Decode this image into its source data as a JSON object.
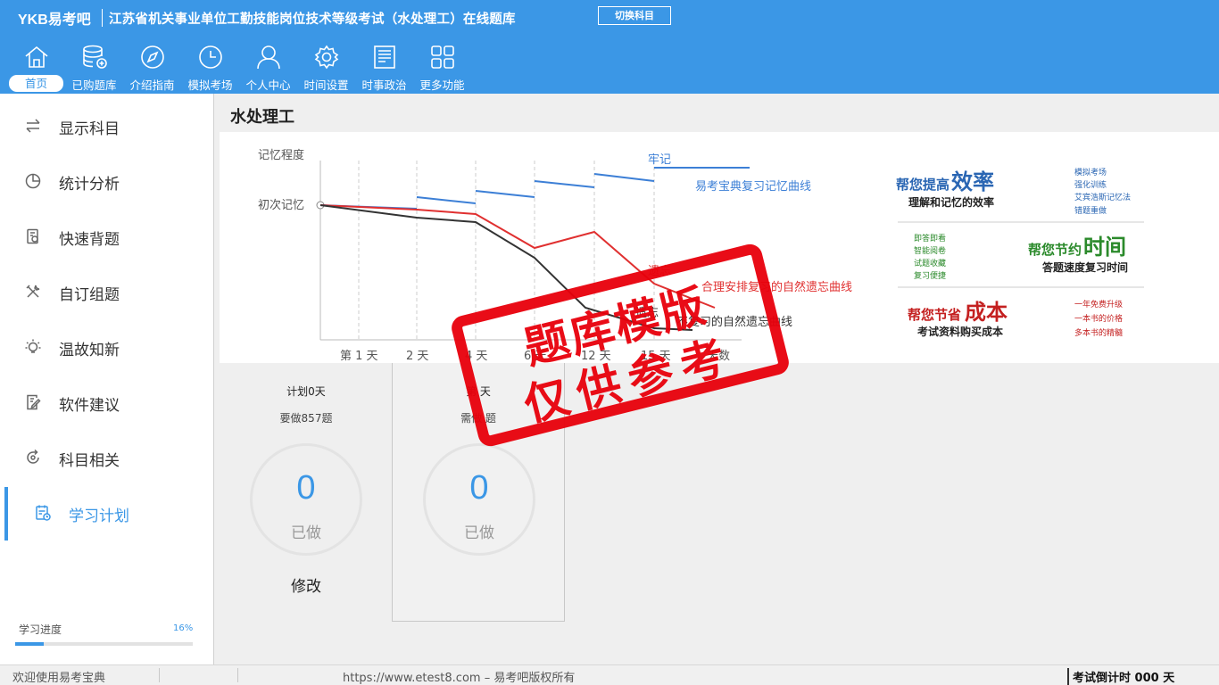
{
  "header": {
    "logo": "YKB易考吧",
    "title": "江苏省机关事业单位工勤技能岗位技术等级考试（水处理工）在线题库",
    "switch_button": "切换科目",
    "nav": [
      {
        "label": "首页",
        "icon": "home-icon"
      },
      {
        "label": "已购题库",
        "icon": "database-icon"
      },
      {
        "label": "介绍指南",
        "icon": "compass-icon"
      },
      {
        "label": "模拟考场",
        "icon": "clock-icon"
      },
      {
        "label": "个人中心",
        "icon": "user-icon"
      },
      {
        "label": "时间设置",
        "icon": "gear-icon"
      },
      {
        "label": "时事政治",
        "icon": "newspaper-icon"
      },
      {
        "label": "更多功能",
        "icon": "grid-icon"
      }
    ]
  },
  "sidebar": {
    "items": [
      {
        "label": "显示科目",
        "icon": "switch-arrows-icon"
      },
      {
        "label": "统计分析",
        "icon": "pie-chart-icon"
      },
      {
        "label": "快速背题",
        "icon": "flashcard-icon"
      },
      {
        "label": "自订组题",
        "icon": "tools-icon"
      },
      {
        "label": "温故知新",
        "icon": "lightbulb-icon"
      },
      {
        "label": "软件建议",
        "icon": "edit-document-icon"
      },
      {
        "label": "科目相关",
        "icon": "refresh-icon"
      },
      {
        "label": "学习计划",
        "icon": "calendar-icon"
      }
    ],
    "progress_label": "学习进度",
    "progress_value": "16%",
    "progress_fraction": 0.16
  },
  "main": {
    "subject_title": "水处理工",
    "banner": {
      "y_axis_label": "记忆程度",
      "first_memory": "初次记忆",
      "firm_memory": "牢记",
      "forget_label": "遗忘",
      "forget_label2": "遗忘",
      "curve_blue": "易考宝典复习记忆曲线",
      "curve_red": "合理安排复习的自然遗忘曲线",
      "curve_black": "不复习的自然遗忘曲线",
      "x_ticks": [
        "第 1 天",
        "2 天",
        "4 天",
        "6 天",
        "12 天",
        "15 天",
        "天数"
      ],
      "promo": {
        "efficiency_prefix": "帮您提高",
        "efficiency_word": "效率",
        "efficiency_sub": "理解和记忆的效率",
        "efficiency_list": [
          "模拟考场",
          "强化训练",
          "艾宾浩斯记忆法",
          "错题重做"
        ],
        "time_list": [
          "即答即看",
          "智能阅卷",
          "试题收藏",
          "复习便捷"
        ],
        "time_prefix": "帮您节约",
        "time_word": "时间",
        "time_sub": "答题速度复习时间",
        "cost_prefix": "帮您节省",
        "cost_word": "成本",
        "cost_sub": "考试资料购买成本",
        "cost_list": [
          "一年免费升级",
          "一本书的价格",
          "多本书的精髓"
        ]
      }
    },
    "cards": [
      {
        "top": "计划0天",
        "sub": "要做857题",
        "count": "0",
        "count_label": "已做",
        "edit": "修改"
      },
      {
        "top": "第  天",
        "sub": "需做  题",
        "count": "0",
        "count_label": "已做"
      }
    ],
    "stamp": {
      "line1": "题库模版",
      "line2": "仅供参考"
    }
  },
  "statusbar": {
    "welcome": "欢迎使用易考宝典",
    "copyright": "https://www.etest8.com – 易考吧版权所有",
    "countdown": "考试倒计时 000 天"
  },
  "colors": {
    "brand": "#3b97e6",
    "stamp": "#e8000b",
    "red_curve": "#e03030",
    "black_curve": "#333333"
  }
}
